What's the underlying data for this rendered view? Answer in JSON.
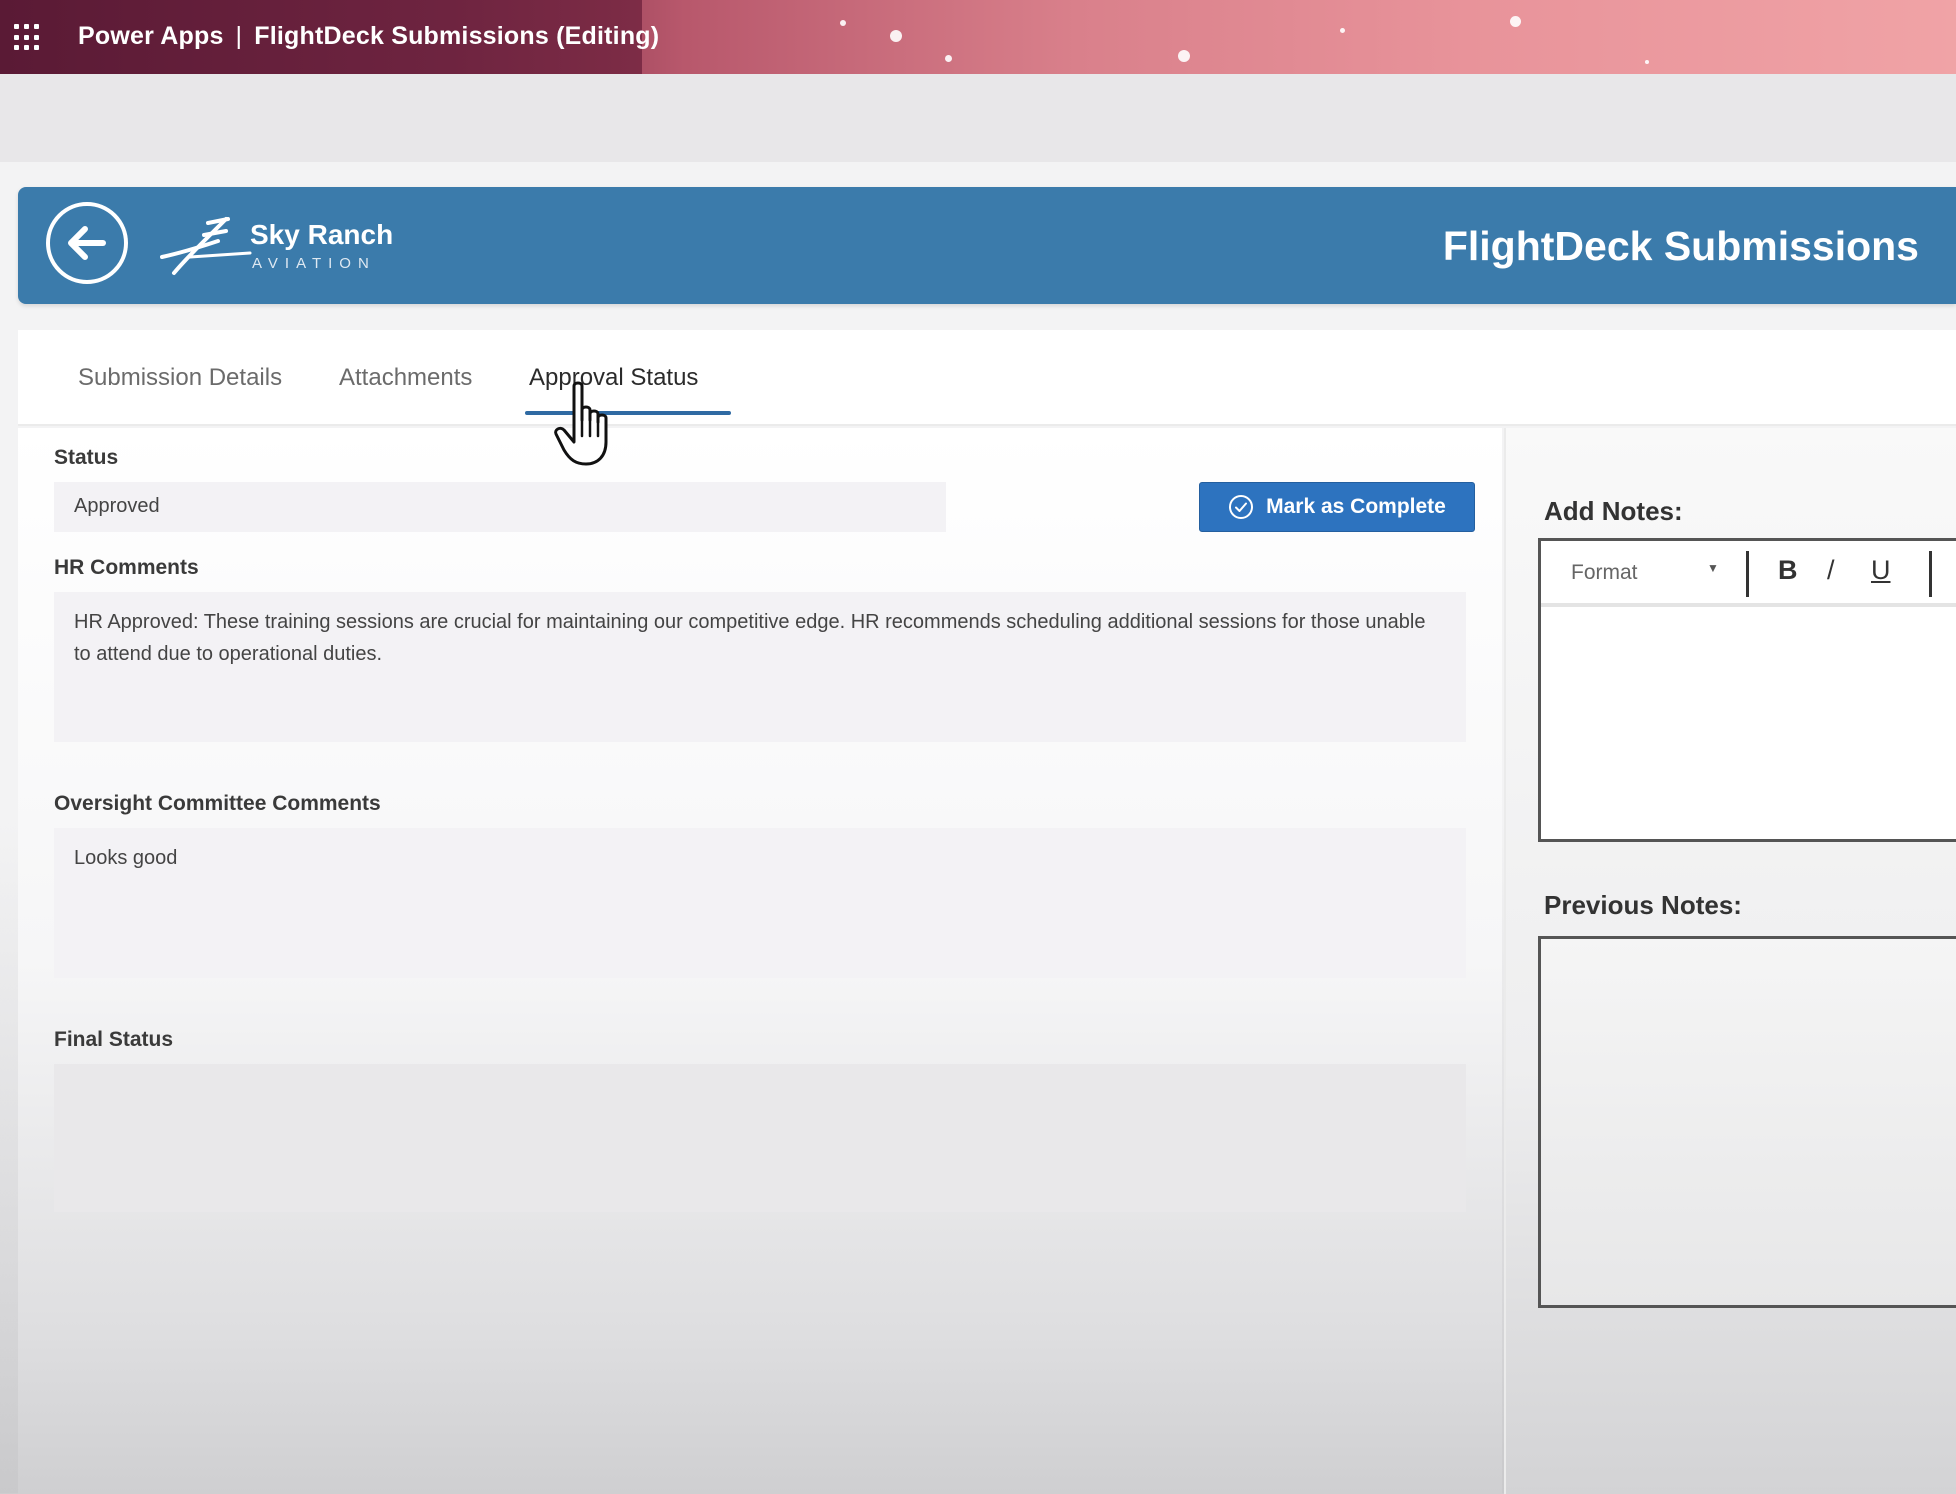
{
  "appbar": {
    "product": "Power Apps",
    "separator": "|",
    "app_name": "FlightDeck Submissions (Editing)"
  },
  "header": {
    "logo_name": "Sky Ranch",
    "logo_tagline": "AVIATION",
    "title": "FlightDeck Submissions"
  },
  "tabs": [
    {
      "label": "Submission Details"
    },
    {
      "label": "Attachments"
    },
    {
      "label": "Approval Status",
      "active": true
    }
  ],
  "form": {
    "status": {
      "label": "Status",
      "value": "Approved"
    },
    "mark_complete_label": "Mark as Complete",
    "hr_comments": {
      "label": "HR Comments",
      "value": "HR Approved: These training sessions are crucial for maintaining our competitive edge. HR recommends scheduling additional sessions for those unable to attend due to operational duties."
    },
    "oversight_comments": {
      "label": "Oversight Committee Comments",
      "value": "Looks good"
    },
    "final_status": {
      "label": "Final Status",
      "value": ""
    }
  },
  "notes": {
    "add_label": "Add Notes:",
    "format_label": "Format",
    "bold": "B",
    "italic": "/",
    "underline": "U",
    "previous_label": "Previous Notes:"
  },
  "colors": {
    "header_blue": "#3b7bab",
    "button_blue": "#2d73bf",
    "tab_underline": "#2f6aa3"
  },
  "icons": [
    "app-launcher-icon",
    "back-arrow-icon",
    "checkmark-circle-icon",
    "dropdown-caret-icon",
    "hand-cursor-icon"
  ]
}
